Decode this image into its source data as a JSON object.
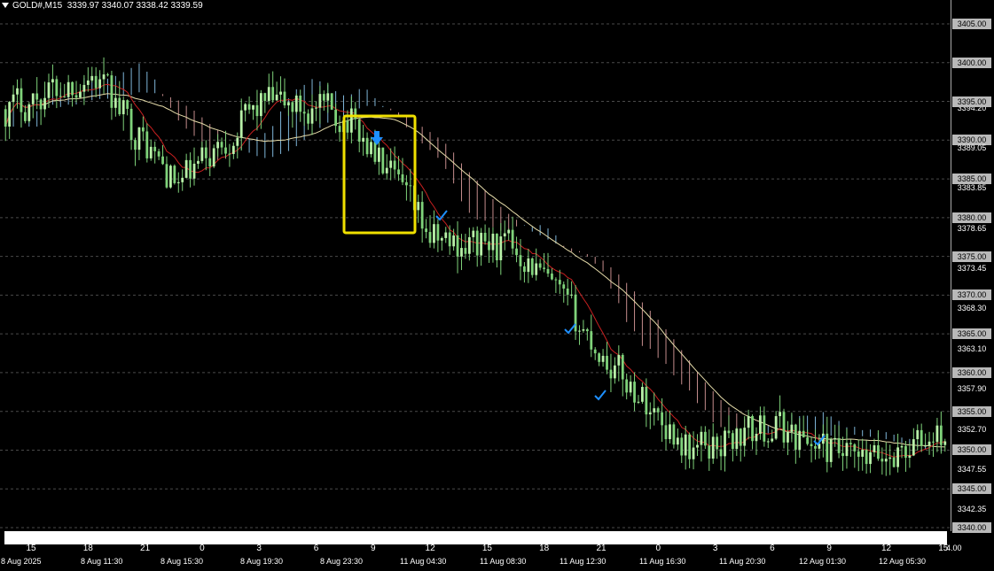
{
  "header": {
    "symbol_tf": "GOLD#,M15",
    "ohlc": "3339.97 3340.07 3338.42 3339.59"
  },
  "colors": {
    "background": "#000000",
    "bull_candle": "#b8f0a8",
    "bear_candle": "#7fd27a",
    "kumo_bear": "#c48c8c",
    "kumo_bull": "#7fb6d9",
    "kijun": "#c82020",
    "ma_slow": "#e6dcaa",
    "highlight_box": "#f0e000",
    "signal_arrow": "#1e90ff",
    "grid": "#4a4a4a"
  },
  "price_scale": {
    "labels": [
      "3405.00",
      "3400.00",
      "3394.20",
      "3395.00",
      "3390.00",
      "3389.05",
      "3385.00",
      "3383.85",
      "3380.00",
      "3378.65",
      "3375.00",
      "3373.45",
      "3370.00",
      "3368.30",
      "3365.00",
      "3363.10",
      "3360.00",
      "3357.90",
      "3355.00",
      "3352.70",
      "3350.00",
      "3347.55",
      "3345.00",
      "3342.35",
      "3340.00"
    ],
    "boxed": [
      "3405.00",
      "3400.00",
      "3395.00",
      "3390.00",
      "3385.00",
      "3380.00",
      "3375.00",
      "3370.00",
      "3365.00",
      "3360.00",
      "3355.00",
      "3350.00",
      "3345.00",
      "3340.00"
    ],
    "range": [
      3339.9,
      3406.6
    ]
  },
  "hour_labels": [
    "15",
    "18",
    "21",
    "0",
    "3",
    "6",
    "9",
    "12",
    "15",
    "18",
    "21",
    "0",
    "3",
    "6",
    "9",
    "12",
    "15"
  ],
  "date_labels": [
    "8 Aug 2025",
    "8 Aug 11:30",
    "8 Aug 15:30",
    "8 Aug 19:30",
    "8 Aug 23:30",
    "11 Aug 04:30",
    "11 Aug 08:30",
    "11 Aug 12:30",
    "11 Aug 16:30",
    "11 Aug 20:30",
    "12 Aug 01:30",
    "12 Aug 05:30"
  ],
  "corner_text": "4.00",
  "signals": {
    "down_arrow": "sell-arrow-icon",
    "checks": [
      "checkmark-icon",
      "checkmark-icon",
      "checkmark-icon",
      "checkmark-icon"
    ]
  },
  "chart_data": {
    "type": "candlestick",
    "symbol": "GOLD#",
    "timeframe": "M15",
    "ylim": [
      3339.9,
      3406.6
    ],
    "grid": true,
    "approx_close_path": [
      [
        "8 Aug 2025",
        3394.0
      ],
      [
        "8 Aug 11:30",
        3398.5
      ],
      [
        "8 Aug 15:30",
        3384.0
      ],
      [
        "8 Aug 19:30",
        3395.0
      ],
      [
        "8 Aug 23:30",
        3393.0
      ],
      [
        "11 Aug 04:30",
        3377.0
      ],
      [
        "11 Aug 08:30",
        3376.0
      ],
      [
        "11 Aug 12:30",
        3362.0
      ],
      [
        "11 Aug 16:30",
        3350.0
      ],
      [
        "11 Aug 20:30",
        3353.0
      ],
      [
        "12 Aug 01:30",
        3348.0
      ],
      [
        "12 Aug 05:30",
        3352.0
      ]
    ],
    "indicators": [
      "Ichimoku cloud",
      "Kijun line",
      "Moving average"
    ]
  }
}
